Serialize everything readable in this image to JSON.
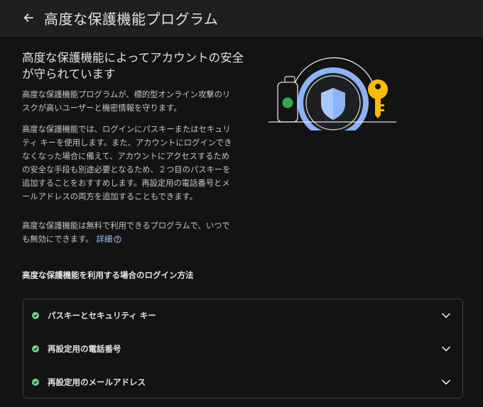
{
  "header": {
    "title": "高度な保護機能プログラム",
    "back_icon": "arrow-back-icon"
  },
  "hero": {
    "title": "高度な保護機能によってアカウントの安全が守られています"
  },
  "paragraphs": {
    "p1": "高度な保護機能プログラムが、標的型オンライン攻撃のリスクが高いユーザーと機密情報を守ります。",
    "p2": "高度な保護機能では、ログインにパスキーまたはセキュリティ キーを使用します。また、アカウントにログインできなくなった場合に備えて、アカウントにアクセスするための安全な手段も別途必要となるため、２つ目のパスキーを追加することをおすすめします。再設定用の電話番号とメールアドレスの両方を追加することもできます。",
    "p3": "高度な保護機能は無料で利用できるプログラムで、いつでも無効にできます。",
    "details_link": "詳細"
  },
  "methods": {
    "title": "高度な保護機能を利用する場合のログイン方法",
    "items": [
      {
        "label": "パスキーとセキュリティ キー"
      },
      {
        "label": "再設定用の電話番号"
      },
      {
        "label": "再設定用のメールアドレス"
      }
    ]
  },
  "colors": {
    "background": "#131314",
    "topbar": "#1e1f20",
    "check_green": "#6dd58c",
    "link_blue": "#a8c7fa",
    "shield_blue": "#8ab4f8",
    "key_yellow": "#fbbc04"
  }
}
